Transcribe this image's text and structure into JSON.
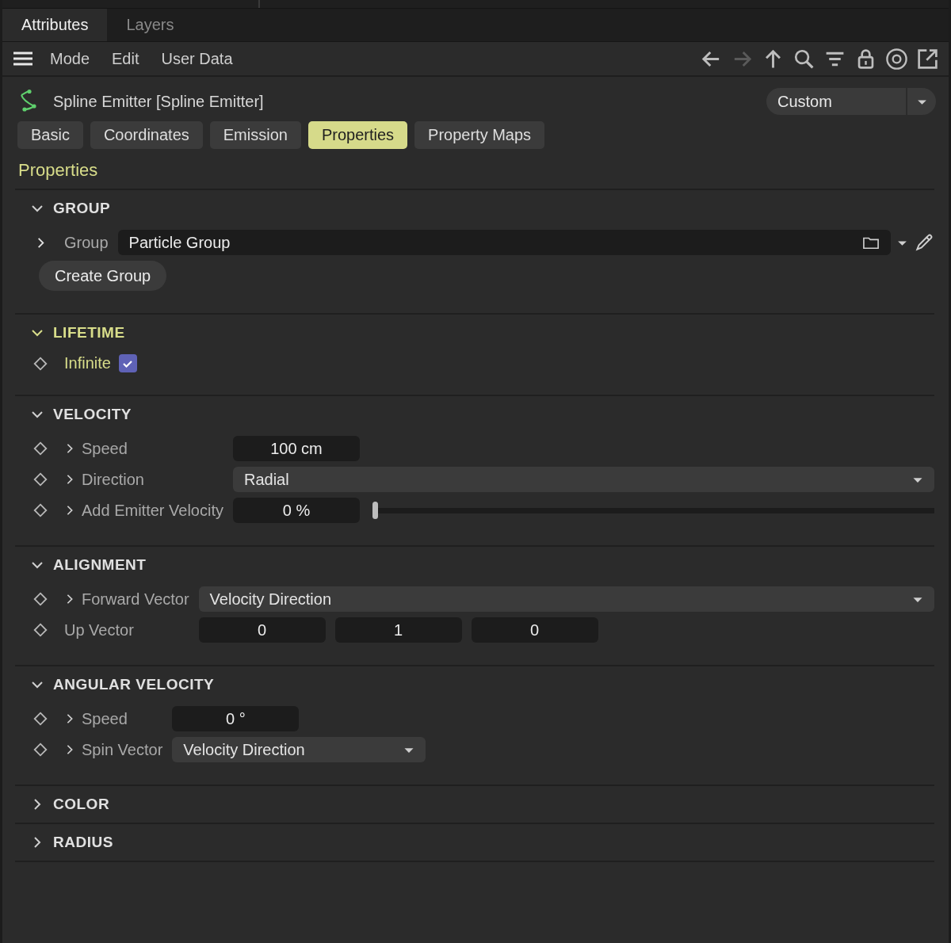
{
  "top_tabs": [
    {
      "label": "Attributes",
      "selected": true
    },
    {
      "label": "Layers",
      "selected": false
    }
  ],
  "menu": [
    "Mode",
    "Edit",
    "User Data"
  ],
  "toolbar": [
    {
      "kind": "back",
      "disabled": false
    },
    {
      "kind": "forward",
      "disabled": true
    },
    {
      "kind": "up",
      "disabled": false
    },
    {
      "kind": "search",
      "disabled": false
    },
    {
      "kind": "filter",
      "disabled": false
    },
    {
      "kind": "lock",
      "disabled": false
    },
    {
      "kind": "target",
      "disabled": false
    },
    {
      "kind": "new_window",
      "disabled": false
    }
  ],
  "object": {
    "title": "Spline Emitter [Spline Emitter]",
    "preset": "Custom"
  },
  "tabs": [
    {
      "label": "Basic",
      "selected": false
    },
    {
      "label": "Coordinates",
      "selected": false
    },
    {
      "label": "Emission",
      "selected": false
    },
    {
      "label": "Properties",
      "selected": true
    },
    {
      "label": "Property Maps",
      "selected": false
    }
  ],
  "heading": "Properties",
  "sections": [
    {
      "title": "GROUP",
      "expanded": true,
      "highlighted": false,
      "rows": [
        {
          "kind": "link",
          "label": "Group",
          "keyframe": false,
          "expander": true,
          "highlighted": false,
          "value": "Particle Group"
        },
        {
          "kind": "button",
          "label": "Create Group"
        }
      ]
    },
    {
      "title": "LIFETIME",
      "expanded": true,
      "highlighted": true,
      "rows": [
        {
          "kind": "checkbox",
          "label": "Infinite",
          "keyframe": true,
          "expander": false,
          "highlighted": true,
          "checked": true
        }
      ]
    },
    {
      "title": "VELOCITY",
      "expanded": true,
      "highlighted": false,
      "rows": [
        {
          "kind": "number",
          "label": "Speed",
          "keyframe": true,
          "expander": true,
          "highlighted": false,
          "value": "100 cm"
        },
        {
          "kind": "dropdown",
          "label": "Direction",
          "keyframe": true,
          "expander": true,
          "highlighted": false,
          "value": "Radial",
          "wide": true
        },
        {
          "kind": "slider",
          "label": "Add Emitter Velocity",
          "keyframe": true,
          "expander": true,
          "highlighted": false,
          "value": "0 %",
          "level": 0
        }
      ]
    },
    {
      "title": "ALIGNMENT",
      "expanded": true,
      "highlighted": false,
      "rows": [
        {
          "kind": "dropdown",
          "label": "Forward Vector",
          "keyframe": true,
          "expander": true,
          "highlighted": false,
          "value": "Velocity Direction",
          "wide": true
        },
        {
          "kind": "vector",
          "label": "Up Vector",
          "keyframe": true,
          "expander": false,
          "highlighted": false,
          "values": [
            "0",
            "1",
            "0"
          ]
        }
      ]
    },
    {
      "title": "ANGULAR VELOCITY",
      "expanded": true,
      "highlighted": false,
      "rows": [
        {
          "kind": "number",
          "label": "Speed",
          "keyframe": true,
          "expander": true,
          "highlighted": false,
          "value": "0 °"
        },
        {
          "kind": "dropdown",
          "label": "Spin Vector",
          "keyframe": true,
          "expander": true,
          "highlighted": false,
          "value": "Velocity Direction",
          "wide": false
        }
      ]
    },
    {
      "title": "COLOR",
      "expanded": false,
      "highlighted": false
    },
    {
      "title": "RADIUS",
      "expanded": false,
      "highlighted": false
    }
  ]
}
